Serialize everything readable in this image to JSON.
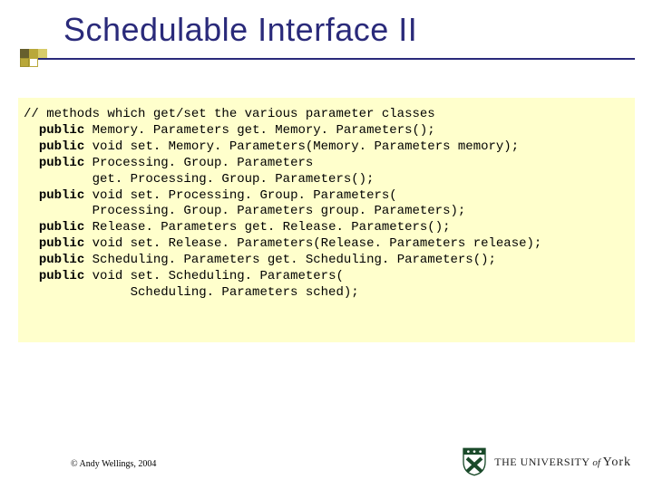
{
  "title": "Schedulable Interface II",
  "code": {
    "comment": "// methods which get/set the various parameter classes",
    "lines": [
      {
        "kw": "public",
        "rest": " Memory. Parameters get. Memory. Parameters();"
      },
      {
        "kw": "public",
        "rest": " void set. Memory. Parameters(Memory. Parameters memory);"
      },
      {
        "kw": "public",
        "rest": " Processing. Group. Parameters"
      },
      {
        "kw": "",
        "rest": "       get. Processing. Group. Parameters();"
      },
      {
        "kw": "public",
        "rest": " void set. Processing. Group. Parameters("
      },
      {
        "kw": "",
        "rest": "       Processing. Group. Parameters group. Parameters);"
      },
      {
        "kw": "public",
        "rest": " Release. Parameters get. Release. Parameters();"
      },
      {
        "kw": "public",
        "rest": " void set. Release. Parameters(Release. Parameters release);"
      },
      {
        "kw": "public",
        "rest": " Scheduling. Parameters get. Scheduling. Parameters();"
      },
      {
        "kw": "public",
        "rest": " void set. Scheduling. Parameters("
      },
      {
        "kw": "",
        "rest": "            Scheduling. Parameters sched);"
      }
    ]
  },
  "copyright": "© Andy Wellings, 2004",
  "university": {
    "the": "THE ",
    "univ": "UNIVERSITY",
    "of": " of ",
    "york": "York"
  }
}
